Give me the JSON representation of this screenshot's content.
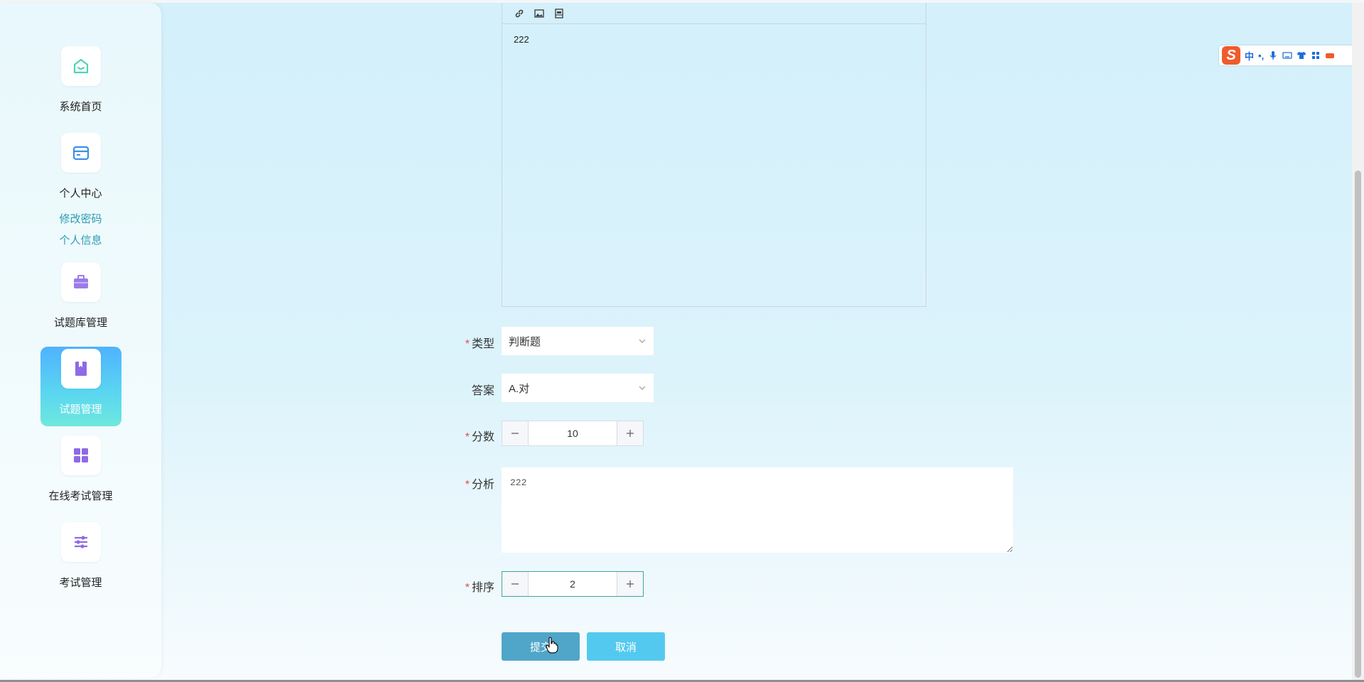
{
  "sidebar": {
    "items": [
      {
        "label": "系统首页",
        "icon": "home-icon"
      },
      {
        "label": "个人中心",
        "icon": "card-icon"
      },
      {
        "label": "试题库管理",
        "icon": "briefcase-icon"
      },
      {
        "label": "试题管理",
        "icon": "book-icon",
        "active": true
      },
      {
        "label": "在线考试管理",
        "icon": "grid-icon"
      },
      {
        "label": "考试管理",
        "icon": "sliders-icon"
      }
    ],
    "submenu": [
      "修改密码",
      "个人信息"
    ]
  },
  "editor": {
    "content": "222",
    "toolbar": [
      "link-icon",
      "image-icon",
      "video-icon"
    ]
  },
  "form": {
    "type_label": "类型",
    "type_value": "判断题",
    "answer_label": "答案",
    "answer_value": "A.对",
    "score_label": "分数",
    "score_value": "10",
    "analysis_label": "分析",
    "analysis_value": "222",
    "order_label": "排序",
    "order_value": "2",
    "required_mark": "*"
  },
  "buttons": {
    "submit": "提交",
    "cancel": "取消"
  },
  "ime": {
    "logo": "S",
    "mode": "中",
    "punct": "•,"
  },
  "colors": {
    "accent": "#4fb2ff",
    "submit": "#4fa6c9",
    "cancel": "#54c9ef",
    "required": "#e34b4b",
    "link": "#2d9bb4"
  }
}
